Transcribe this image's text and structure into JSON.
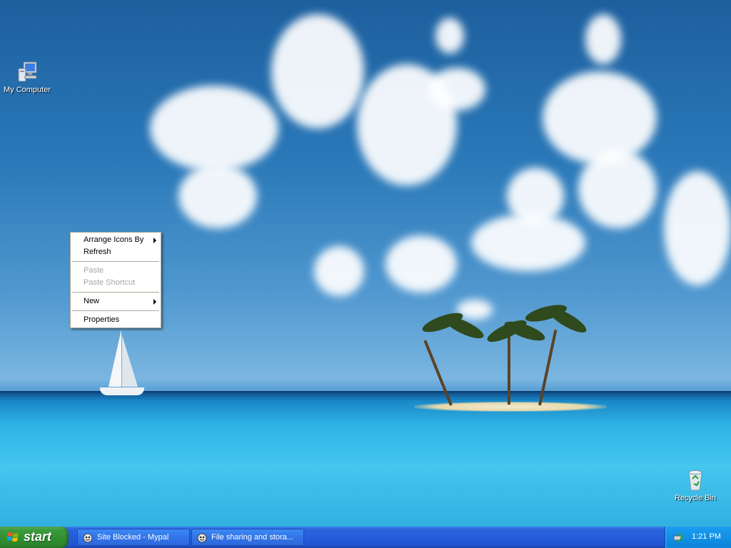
{
  "desktop": {
    "icons": {
      "my_computer": {
        "label": "My Computer",
        "icon": "my-computer-icon"
      },
      "recycle_bin": {
        "label": "Recycle Bin",
        "icon": "recycle-bin-icon"
      }
    }
  },
  "context_menu": {
    "items": [
      {
        "label": "Arrange Icons By",
        "enabled": true,
        "submenu": true
      },
      {
        "label": "Refresh",
        "enabled": true,
        "submenu": false
      },
      {
        "label": "Paste",
        "enabled": false,
        "submenu": false
      },
      {
        "label": "Paste Shortcut",
        "enabled": false,
        "submenu": false
      },
      {
        "label": "New",
        "enabled": true,
        "submenu": true
      },
      {
        "label": "Properties",
        "enabled": true,
        "submenu": false
      }
    ]
  },
  "taskbar": {
    "start_label": "start",
    "tasks": [
      {
        "label": "Site Blocked - Mypal",
        "icon": "mypal-browser-icon"
      },
      {
        "label": "File sharing and stora...",
        "icon": "mypal-browser-icon"
      }
    ],
    "tray": {
      "clock": "1:21 PM",
      "icon": "safely-remove-hardware-icon"
    }
  },
  "colors": {
    "taskbar_blue": "#245ddb",
    "start_green": "#308d30",
    "tray_blue": "#1190e5",
    "menu_border": "#aca899",
    "disabled_text": "#a7a6aa"
  }
}
